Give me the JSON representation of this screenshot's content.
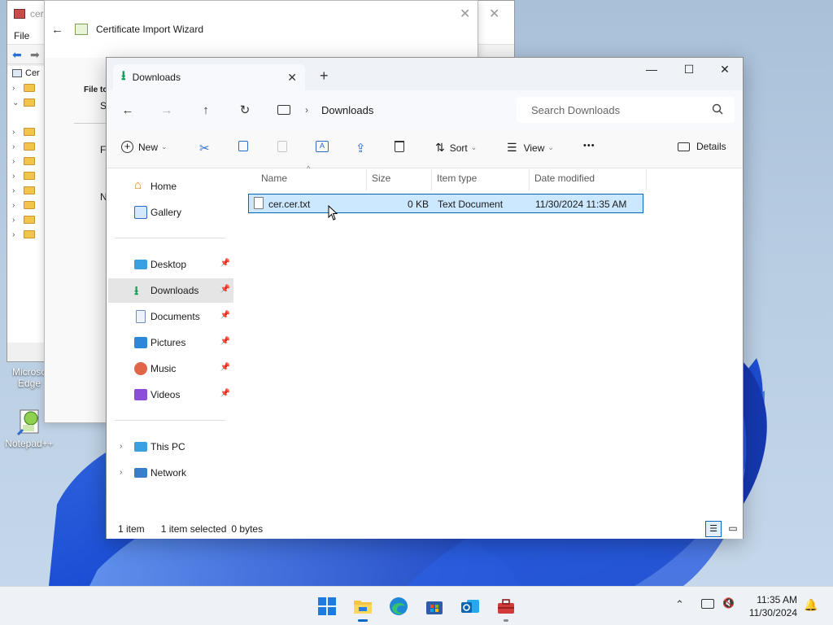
{
  "colors": {
    "accent": "#0067c0",
    "selection_bg": "#cce8ff",
    "nav_selected": "#e5e5e5",
    "download_green": "#0f9d58"
  },
  "desktop": {
    "icons": [
      {
        "label": "Microsoft Edge",
        "line1": "Microso",
        "line2": "Edge",
        "icon": "edge-icon"
      },
      {
        "label": "Notepad++",
        "icon": "notepad-plus-plus-icon"
      }
    ]
  },
  "background_mmc": {
    "title": "cer",
    "menu_file": "File",
    "tree_partial": "Cer"
  },
  "wizard": {
    "title": "Certificate Import Wizard",
    "partial_labels": [
      "File to",
      "S",
      "F",
      "N"
    ]
  },
  "explorer": {
    "tab_label": "Downloads",
    "new_tab_glyph": "+",
    "breadcrumb": "Downloads",
    "search_placeholder": "Search Downloads",
    "commands": {
      "new": "New",
      "sort": "Sort",
      "view": "View",
      "more": "•••",
      "details": "Details"
    },
    "nav": {
      "home": "Home",
      "gallery": "Gallery",
      "quick": [
        {
          "label": "Desktop",
          "icon": "desktop-icon"
        },
        {
          "label": "Downloads",
          "icon": "downloads-icon"
        },
        {
          "label": "Documents",
          "icon": "documents-icon"
        },
        {
          "label": "Pictures",
          "icon": "pictures-icon"
        },
        {
          "label": "Music",
          "icon": "music-icon"
        },
        {
          "label": "Videos",
          "icon": "videos-icon"
        }
      ],
      "this_pc": "This PC",
      "network": "Network"
    },
    "columns": {
      "name": "Name",
      "size": "Size",
      "type": "Item type",
      "date": "Date modified"
    },
    "files": [
      {
        "name": "cer.cer.txt",
        "size": "0 KB",
        "type": "Text Document",
        "date": "11/30/2024 11:35 AM"
      }
    ],
    "status": {
      "count": "1 item",
      "selected": "1 item selected",
      "bytes": "0 bytes"
    }
  },
  "taskbar": {
    "time": "11:35 AM",
    "date": "11/30/2024",
    "apps": [
      "start-icon",
      "file-explorer-icon",
      "edge-icon",
      "store-icon",
      "outlook-icon",
      "toolbox-icon"
    ]
  }
}
